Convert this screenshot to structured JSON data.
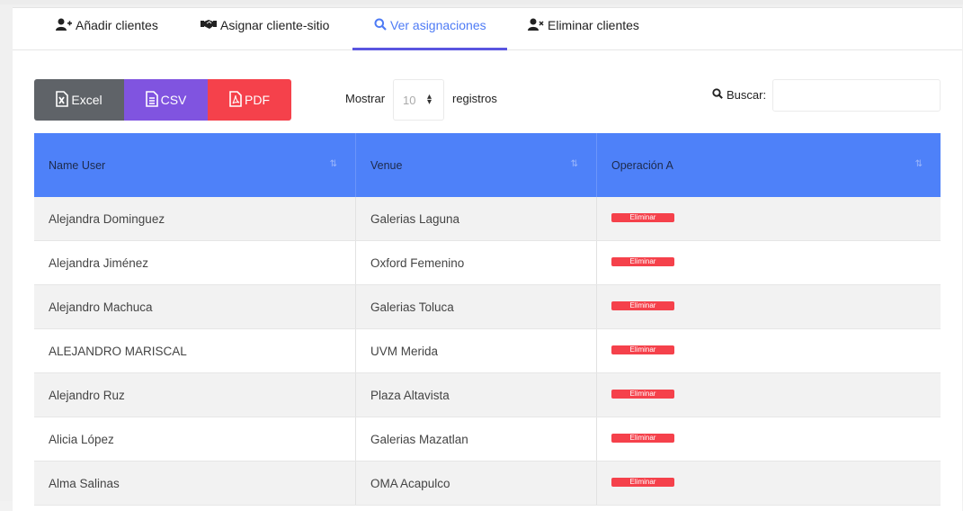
{
  "tabs": [
    {
      "label": "Añadir clientes",
      "icon": "user-plus-icon"
    },
    {
      "label": "Asignar cliente-sitio",
      "icon": "handshake-icon"
    },
    {
      "label": "Ver asignaciones",
      "icon": "search-icon"
    },
    {
      "label": "Eliminar clientes",
      "icon": "user-times-icon"
    }
  ],
  "active_tab": "Ver asignaciones",
  "export": {
    "excel": "Excel",
    "csv": "CSV",
    "pdf": "PDF"
  },
  "length": {
    "show_label": "Mostrar",
    "value": "10",
    "records_label": "registros"
  },
  "search": {
    "label": "Buscar:",
    "value": ""
  },
  "colors": {
    "accent": "#4e81f9",
    "tab_active": "#4e7bf5",
    "excel": "#5f6368",
    "csv": "#8054e0",
    "pdf": "#f5414b",
    "delete": "#f5414b"
  },
  "table": {
    "headers": [
      "Name User",
      "Venue",
      "Operación A"
    ],
    "rows": [
      {
        "name": "Alejandra Dominguez",
        "venue": "Galerias Laguna",
        "action": "Eliminar"
      },
      {
        "name": "Alejandra Jiménez",
        "venue": "Oxford Femenino",
        "action": "Eliminar"
      },
      {
        "name": "Alejandro Machuca",
        "venue": "Galerias Toluca",
        "action": "Eliminar"
      },
      {
        "name": "ALEJANDRO MARISCAL",
        "venue": "UVM Merida",
        "action": "Eliminar"
      },
      {
        "name": "Alejandro Ruz",
        "venue": "Plaza Altavista",
        "action": "Eliminar"
      },
      {
        "name": "Alicia López",
        "venue": "Galerias Mazatlan",
        "action": "Eliminar"
      },
      {
        "name": "Alma Salinas",
        "venue": "OMA Acapulco",
        "action": "Eliminar"
      }
    ]
  }
}
